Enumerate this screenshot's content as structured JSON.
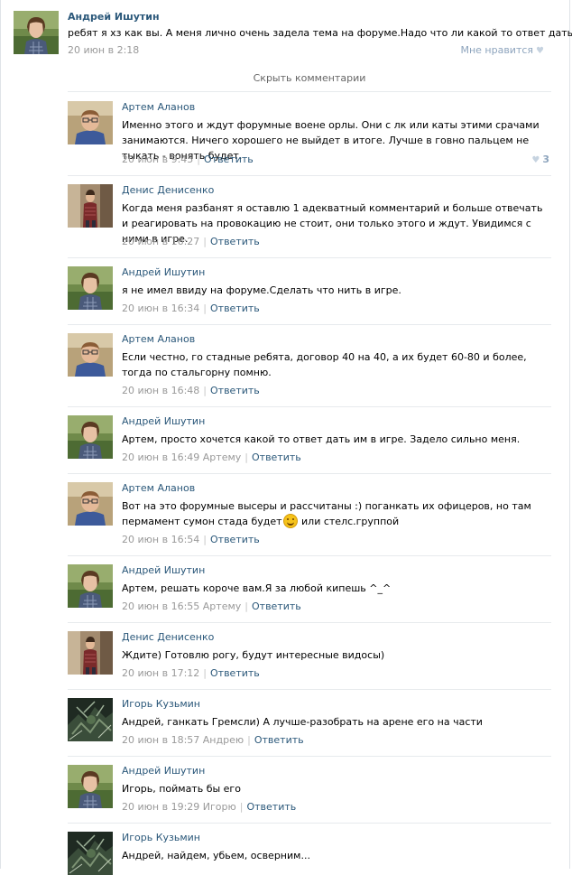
{
  "post": {
    "author": "Андрей Ишутин",
    "text": "ребят я хз как вы. А меня лично очень задела тема на форуме.Надо что ли какой то ответ дать:\\",
    "date": "20 июн в 2:18",
    "like_label": "Мне нравится",
    "like_icon": "heart-icon"
  },
  "hide_comments_label": "Скрыть комментарии",
  "reply_label": "Ответить",
  "comments": [
    {
      "author": "Артем Аланов",
      "text": "Именно этого и ждут форумные военe орлы. Они с лк или каты этими срачами занимаются. Ничего хорошего не выйдет в итоге. Лучше в говно пальцем не тыкать - вонять будет.",
      "date": "20 июн в 9:45",
      "reply_to": "",
      "likes": "3"
    },
    {
      "author": "Денис Денисенко",
      "text": "Когда меня разбанят я оставлю 1 адекватный комментарий и больше отвечать и реагировать на провокацию не стоит, они только этого и ждут. Увидимся с ними в игре.",
      "date": "20 июн в 16:27",
      "reply_to": "",
      "likes": ""
    },
    {
      "author": "Андрей Ишутин",
      "text": "я не имел ввиду на форуме.Сделать что нить в игре.",
      "date": "20 июн в 16:34",
      "reply_to": "",
      "likes": ""
    },
    {
      "author": "Артем Аланов",
      "text": "Если честно, го стадные ребята, договор 40 на 40, а их будет 60-80 и более, тогда по стальгорну помню.",
      "date": "20 июн в 16:48",
      "reply_to": "",
      "likes": ""
    },
    {
      "author": "Андрей Ишутин",
      "text": "Артем, просто хочется какой то ответ дать им в игре. Задело сильно меня.",
      "date": "20 июн в 16:49",
      "reply_to": "Артему",
      "likes": ""
    },
    {
      "author": "Артем Аланов",
      "text_before": "Вот на это форумные высеры и рассчитаны :) поганкать их офицеров, но там пермамент сумон стада будет",
      "text_after": " или стелс.группой",
      "emoji_icon": "smiley-icon",
      "date": "20 июн в 16:54",
      "reply_to": "",
      "likes": ""
    },
    {
      "author": "Андрей Ишутин",
      "text": "Артем, решать короче вам.Я за любой кипешь ^_^",
      "date": "20 июн в 16:55",
      "reply_to": "Артему",
      "likes": ""
    },
    {
      "author": "Денис Денисенко",
      "text": "Ждите) Готовлю рогу, будут интересные видосы)",
      "date": "20 июн в 17:12",
      "reply_to": "",
      "likes": ""
    },
    {
      "author": "Игорь Кузьмин",
      "text": "Андрей, ганкать Гремсли) А лучше-разобрать на арене его на части",
      "date": "20 июн в 18:57",
      "reply_to": "Андрею",
      "likes": ""
    },
    {
      "author": "Андрей Ишутин",
      "text": "Игорь, поймать бы его",
      "date": "20 июн в 19:29",
      "reply_to": "Игорю",
      "likes": ""
    },
    {
      "author": "Игорь Кузьмин",
      "text": "Андрей, найдем, убьем, осверним...",
      "date": "",
      "reply_to": "",
      "likes": ""
    }
  ]
}
